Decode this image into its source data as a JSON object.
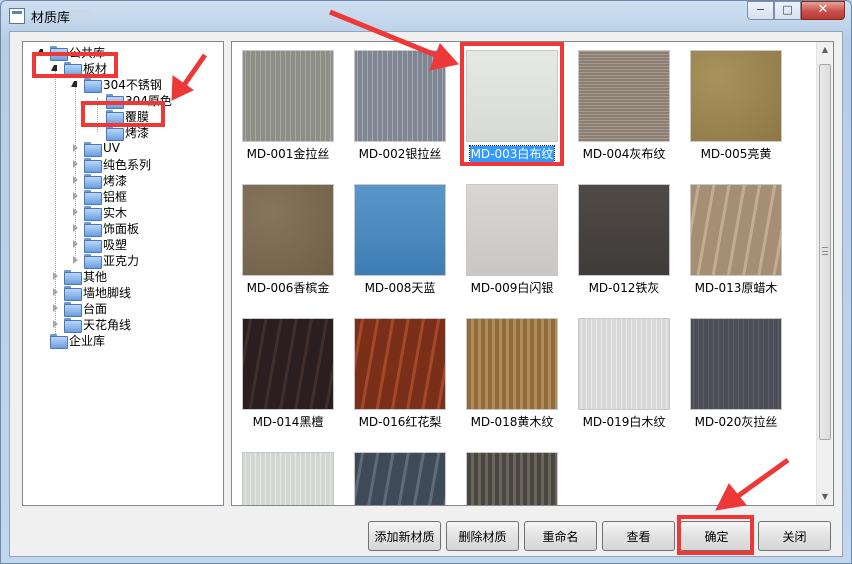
{
  "window": {
    "title": "材质库"
  },
  "tree": [
    {
      "label": "公共库",
      "depth": 0,
      "expanded": true
    },
    {
      "label": "板材",
      "depth": 1,
      "expanded": true
    },
    {
      "label": "304不锈钢",
      "depth": 2,
      "expanded": true
    },
    {
      "label": "304原色",
      "depth": 3,
      "expanded": false
    },
    {
      "label": "覆膜",
      "depth": 3,
      "expanded": false
    },
    {
      "label": "烤漆",
      "depth": 3,
      "expanded": false
    },
    {
      "label": "UV",
      "depth": 2,
      "expanded": false
    },
    {
      "label": "纯色系列",
      "depth": 2,
      "expanded": false
    },
    {
      "label": "烤漆",
      "depth": 2,
      "expanded": false
    },
    {
      "label": "铝框",
      "depth": 2,
      "expanded": false
    },
    {
      "label": "实木",
      "depth": 2,
      "expanded": false
    },
    {
      "label": "饰面板",
      "depth": 2,
      "expanded": false
    },
    {
      "label": "吸塑",
      "depth": 2,
      "expanded": false
    },
    {
      "label": "亚克力",
      "depth": 2,
      "expanded": false
    },
    {
      "label": "其他",
      "depth": 1,
      "expanded": false
    },
    {
      "label": "墙地脚线",
      "depth": 1,
      "expanded": false
    },
    {
      "label": "台面",
      "depth": 1,
      "expanded": false
    },
    {
      "label": "天花角线",
      "depth": 1,
      "expanded": false
    },
    {
      "label": "企业库",
      "depth": 0,
      "expanded": false
    }
  ],
  "materials": [
    {
      "name": "MD-001金拉丝",
      "swatch": [
        "#8e8f86",
        "#a7a79e"
      ],
      "texture": "brushed",
      "selected": false
    },
    {
      "name": "MD-002银拉丝",
      "swatch": [
        "#7f8591",
        "#a2a8b3"
      ],
      "texture": "brushed",
      "selected": false
    },
    {
      "name": "MD-003白布纹",
      "swatch": [
        "#d7d9d7",
        "#e7e9e7"
      ],
      "texture": "plain",
      "selected": true
    },
    {
      "name": "MD-004灰布纹",
      "swatch": [
        "#8a7f72",
        "#a69b8e"
      ],
      "texture": "weave",
      "selected": false
    },
    {
      "name": "MD-005亮黄",
      "swatch": [
        "#8d7845",
        "#a8935d"
      ],
      "texture": "grain",
      "selected": false
    },
    {
      "name": "MD-006香槟金",
      "swatch": [
        "#6f5f47",
        "#86755b"
      ],
      "texture": "grain",
      "selected": false
    },
    {
      "name": "MD-008天蓝",
      "swatch": [
        "#3e7db4",
        "#5a97c9"
      ],
      "texture": "plain",
      "selected": false
    },
    {
      "name": "MD-009白闪银",
      "swatch": [
        "#c9c6c4",
        "#d9d6d4"
      ],
      "texture": "plain",
      "selected": false
    },
    {
      "name": "MD-012铁灰",
      "swatch": [
        "#3f3b38",
        "#4f4a46"
      ],
      "texture": "plain",
      "selected": false
    },
    {
      "name": "MD-013原蜡木",
      "swatch": [
        "#a48f75",
        "#c2ad92"
      ],
      "texture": "wood",
      "selected": false
    },
    {
      "name": "MD-014黑檀",
      "swatch": [
        "#2a1e20",
        "#3f2e2c"
      ],
      "texture": "wood",
      "selected": false
    },
    {
      "name": "MD-016红花梨",
      "swatch": [
        "#7a2f18",
        "#a5492a"
      ],
      "texture": "wood",
      "selected": false
    },
    {
      "name": "MD-018黄木纹",
      "swatch": [
        "#8e6c3d",
        "#b48c55"
      ],
      "texture": "stripe",
      "selected": false
    },
    {
      "name": "MD-019白木纹",
      "swatch": [
        "#d8d8d8",
        "#ececec"
      ],
      "texture": "brushed",
      "selected": false
    },
    {
      "name": "MD-020灰拉丝",
      "swatch": [
        "#4c4d56",
        "#5d5e67"
      ],
      "texture": "brushed",
      "selected": false
    },
    {
      "name": "",
      "swatch": [
        "#d4d6d2",
        "#e6e8e4"
      ],
      "texture": "brushed",
      "selected": false
    },
    {
      "name": "",
      "swatch": [
        "#3f4a58",
        "#5f6b7a"
      ],
      "texture": "wood",
      "selected": false
    },
    {
      "name": "",
      "swatch": [
        "#4a4640",
        "#6a655d"
      ],
      "texture": "stripe",
      "selected": false
    }
  ],
  "buttons": {
    "add": "添加新材质",
    "delete": "删除材质",
    "rename": "重命名",
    "view": "查看",
    "ok": "确定",
    "close": "关闭"
  },
  "window_controls": {
    "minimize": "−",
    "maximize": "□",
    "close": "✕"
  },
  "annotation_color": "#ee3838"
}
